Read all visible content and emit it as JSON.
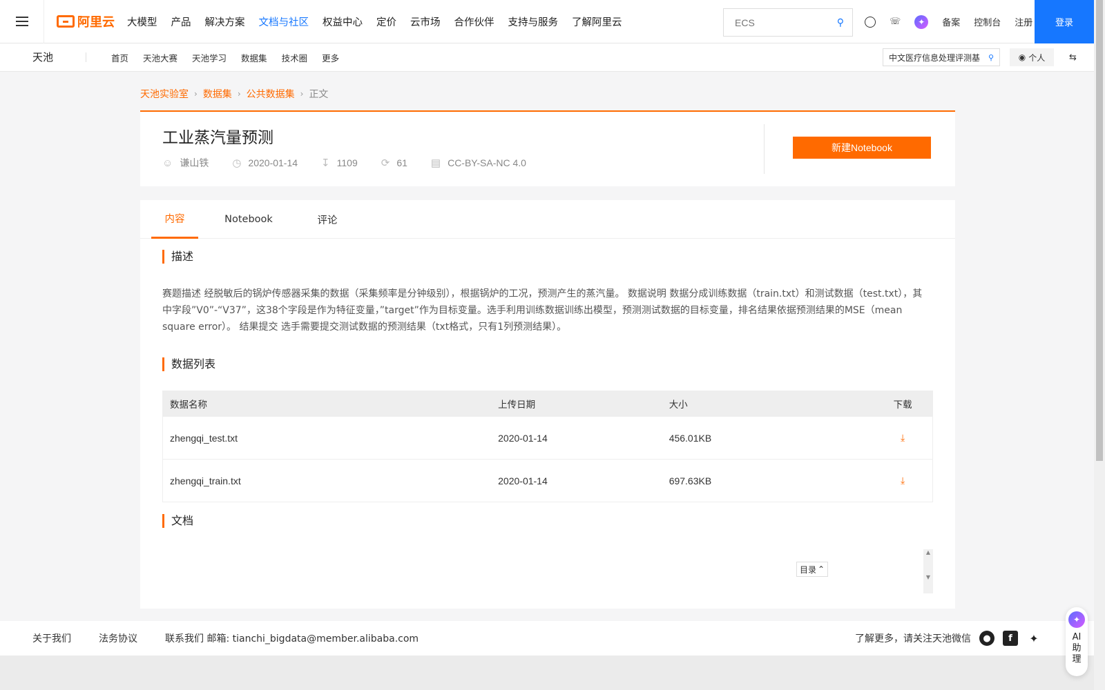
{
  "topnav": {
    "logo_text": "阿里云",
    "items": [
      "大模型",
      "产品",
      "解决方案",
      "文档与社区",
      "权益中心",
      "定价",
      "云市场",
      "合作伙伴",
      "支持与服务",
      "了解阿里云"
    ],
    "active_item": "文档与社区",
    "search_placeholder": "ECS",
    "right_links": [
      "备案",
      "控制台",
      "注册"
    ],
    "login_label": "登录"
  },
  "subnav": {
    "brand": "天池",
    "items": [
      "首页",
      "天池大赛",
      "天池学习",
      "数据集",
      "技术圈",
      "更多"
    ],
    "search_text": "中文医疗信息处理评测基",
    "personal_label": "个人"
  },
  "breadcrumb": [
    "天池实验室",
    "数据集",
    "公共数据集",
    "正文"
  ],
  "dataset": {
    "title": "工业蒸汽量预测",
    "author": "谦山铁",
    "date": "2020-01-14",
    "downloads": "1109",
    "shares": "61",
    "license": "CC-BY-SA-NC 4.0",
    "new_notebook_label": "新建Notebook"
  },
  "tabs": [
    "内容",
    "Notebook",
    "评论"
  ],
  "sections": {
    "description_title": "描述",
    "description_text": "赛题描述 经脱敏后的锅炉传感器采集的数据（采集频率是分钟级别），根据锅炉的工况，预测产生的蒸汽量。 数据说明 数据分成训练数据（train.txt）和测试数据（test.txt），其中字段”V0”-“V37”，这38个字段是作为特征变量，”target”作为目标变量。选手利用训练数据训练出模型，预测测试数据的目标变量，排名结果依据预测结果的MSE（mean square error）。 结果提交 选手需要提交测试数据的预测结果（txt格式，只有1列预测结果）。",
    "datalist_title": "数据列表",
    "doc_title": "文档",
    "toc_label": "目录"
  },
  "table": {
    "headers": [
      "数据名称",
      "上传日期",
      "大小",
      "下载"
    ],
    "rows": [
      {
        "name": "zhengqi_test.txt",
        "date": "2020-01-14",
        "size": "456.01KB"
      },
      {
        "name": "zhengqi_train.txt",
        "date": "2020-01-14",
        "size": "697.63KB"
      }
    ]
  },
  "footer": {
    "links": [
      "关于我们",
      "法务协议"
    ],
    "contact": "联系我们 邮箱: tianchi_bigdata@member.alibaba.com",
    "follow_text": "了解更多，请关注天池微信"
  },
  "ai_assistant": {
    "label": "AI助理"
  },
  "colors": {
    "accent": "#ff6a00",
    "primary_blue": "#1677ff"
  }
}
